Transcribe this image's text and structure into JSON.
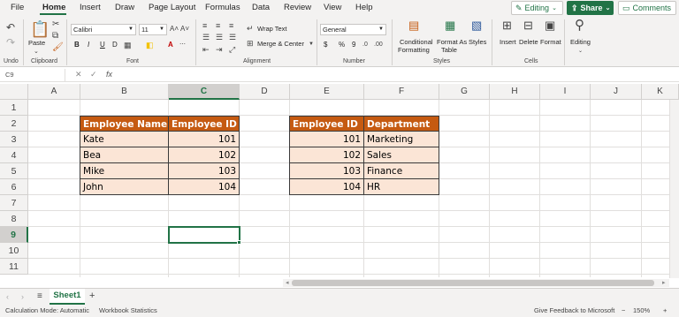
{
  "menu": {
    "items": [
      "File",
      "Home",
      "Insert",
      "Draw",
      "Page Layout",
      "Formulas",
      "Data",
      "Review",
      "View",
      "Help"
    ],
    "editing_label": "Editing",
    "share_label": "Share",
    "comments_label": "Comments"
  },
  "ribbon": {
    "undo_label": "Undo",
    "paste_label": "Paste",
    "clipboard_label": "Clipboard",
    "font_name": "Calibri",
    "font_size": "11",
    "font_label": "Font",
    "wrap_text_label": "Wrap Text",
    "merge_center_label": "Merge & Center",
    "alignment_label": "Alignment",
    "number_format": "General",
    "number_label": "Number",
    "conditional_formatting_label_1": "Conditional",
    "conditional_formatting_label_2": "Formatting",
    "format_as_table_label_1": "Format As",
    "format_as_table_label_2": "Table",
    "styles_button_label": "Styles",
    "styles_label": "Styles",
    "insert_label": "Insert",
    "delete_label": "Delete",
    "format_label": "Format",
    "cells_label": "Cells",
    "editing_group_label": "Editing",
    "bold": "B",
    "italic": "I",
    "underline": "U",
    "strike": "D",
    "font_color_glyph": "A",
    "currency_glyph": "$",
    "percent_glyph": "%",
    "comma_glyph": "9"
  },
  "formula_bar": {
    "name_box": "C9",
    "fx": "fx",
    "formula": ""
  },
  "grid": {
    "columns": [
      "A",
      "B",
      "C",
      "D",
      "E",
      "F",
      "G",
      "H",
      "I",
      "J",
      "K"
    ],
    "rows": [
      "1",
      "2",
      "3",
      "4",
      "5",
      "6",
      "7",
      "8",
      "9",
      "10",
      "11"
    ],
    "selected_column": "C",
    "selected_row": "9"
  },
  "table1": {
    "headers": [
      "Employee Name",
      "Employee ID"
    ],
    "rows": [
      [
        "Kate",
        "101"
      ],
      [
        "Bea",
        "102"
      ],
      [
        "Mike",
        "103"
      ],
      [
        "John",
        "104"
      ]
    ]
  },
  "table2": {
    "headers": [
      "Employee ID",
      "Department"
    ],
    "rows": [
      [
        "101",
        "Marketing"
      ],
      [
        "102",
        "Sales"
      ],
      [
        "103",
        "Finance"
      ],
      [
        "104",
        "HR"
      ]
    ]
  },
  "sheets": {
    "active": "Sheet1",
    "add_glyph": "+"
  },
  "status": {
    "calc_mode": "Calculation Mode: Automatic",
    "workbook_stats": "Workbook Statistics",
    "feedback": "Give Feedback to Microsoft",
    "zoom": "150%"
  },
  "colors": {
    "accent": "#217346",
    "header_fill": "#c55a11",
    "body_fill": "#fbe5d6"
  }
}
